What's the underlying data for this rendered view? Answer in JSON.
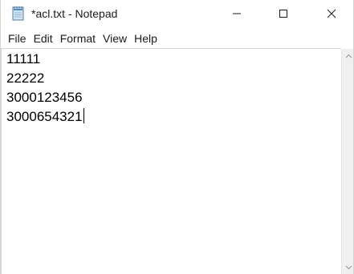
{
  "window": {
    "title": "*acl.txt - Notepad",
    "icon": "notepad-icon"
  },
  "titlebar_buttons": {
    "minimize_icon": "minimize-icon",
    "maximize_icon": "maximize-icon",
    "close_icon": "close-icon"
  },
  "menu": {
    "items": [
      "File",
      "Edit",
      "Format",
      "View",
      "Help"
    ]
  },
  "editor": {
    "lines": [
      "11111",
      "22222",
      "3000123456",
      "3000654321"
    ]
  },
  "colors": {
    "text": "#000000",
    "chrome": "#ffffff",
    "scrollbar": "#f0f0f0"
  }
}
